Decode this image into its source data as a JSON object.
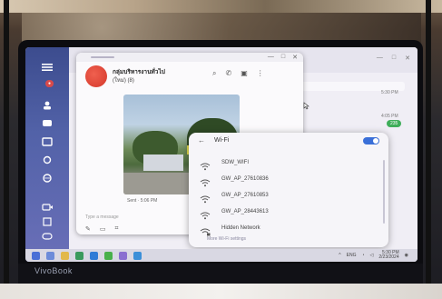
{
  "laptop": {
    "brand": "VivoBook"
  },
  "background_app": {
    "time_top": "5:30 PM",
    "time_mid": "4:05 PM",
    "badge": "235"
  },
  "chat": {
    "title": "กลุ่มบริหารงานทั่วไป",
    "subtitle": "(ใหม่) (8)",
    "caption": "Sent · 5:06 PM",
    "input_placeholder": "Type a message"
  },
  "wifi": {
    "title": "Wi-Fi",
    "enabled": true,
    "networks": [
      {
        "name": "SDW_WIFI"
      },
      {
        "name": "GW_AP_27610836"
      },
      {
        "name": "GW_AP_27610853"
      },
      {
        "name": "GW_AP_28443613"
      },
      {
        "name": "Hidden Network"
      }
    ],
    "more_link": "More Wi-Fi settings"
  },
  "taskbar": {
    "lang": "ENG",
    "time": "5:30 PM",
    "date": "2/23/2024"
  },
  "colors": {
    "rail": "#4656a0",
    "accent": "#3a6fd8",
    "avatar": "#e04b3c",
    "badge_green": "#3fae5a"
  }
}
